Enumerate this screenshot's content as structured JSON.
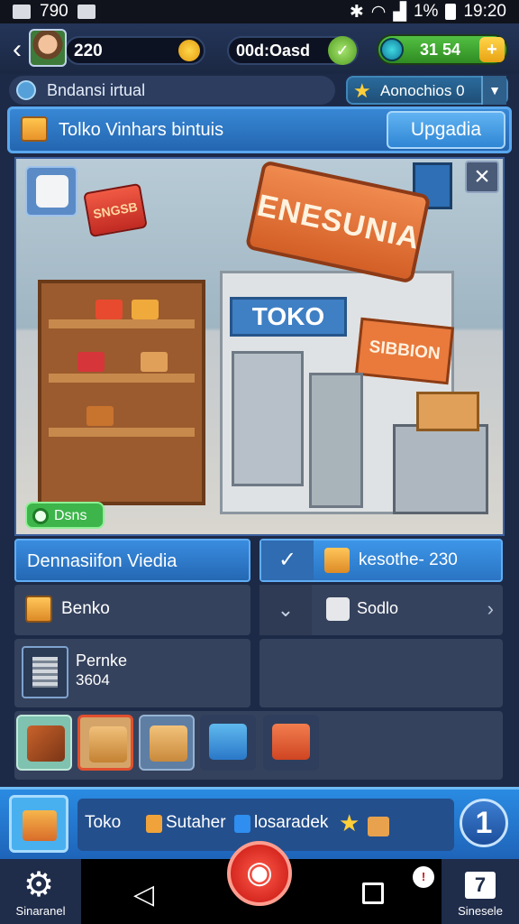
{
  "status_bar": {
    "left_time": "790",
    "battery_pct": "1%",
    "clock": "19:20"
  },
  "resources": {
    "score": "220",
    "gems": "00d:Oasd",
    "energy": "31 54"
  },
  "info": {
    "label": "Bndansi irtual",
    "notice": "Aonochios 0"
  },
  "banner": {
    "title": "Tolko Vinhars bintuis",
    "upgrade_label": "Upgadia"
  },
  "scene": {
    "sign_text": "ENESUNIA",
    "awning_text": "TOKO",
    "side_sign_text": "SIBBION",
    "red_tag_text": "SNGSB",
    "green_badge": "Dsns"
  },
  "list": {
    "row1_left": "Dennasiifon Viedia",
    "row1_right": "kesothe- 230",
    "row2_left": "Benko",
    "row2_right": "Sodlo",
    "row3_left_name": "Pernke",
    "row3_left_value": "3604"
  },
  "action_bar": {
    "label_1": "Toko",
    "label_2": "Sutaher",
    "label_3": "losaradek",
    "count": "1"
  },
  "nav": {
    "left_label": "Sinaranel",
    "right_label": "Sinesele"
  },
  "colors": {
    "accent_blue": "#2a74c3",
    "panel": "#35425d",
    "highlight_orange": "#e0502f"
  }
}
